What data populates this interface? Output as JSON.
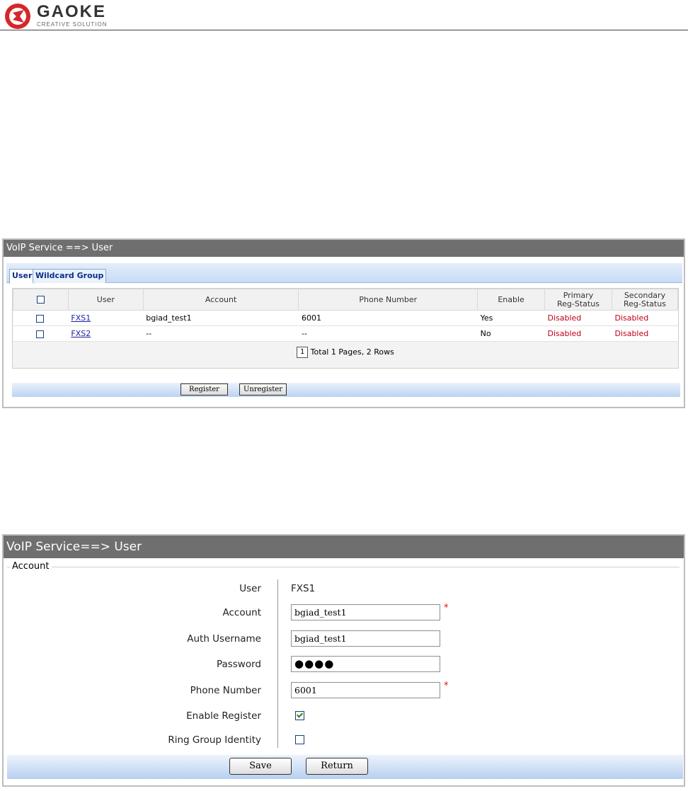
{
  "header": {
    "brand": "GAOKE",
    "tagline": "CREATIVE SOLUTION"
  },
  "colors": {
    "title_bar": "#6f6f6f",
    "tab_text": "#0b2f88",
    "status_red": "#c2001a",
    "link_blue": "#1e1fa6",
    "required_red": "#e01010"
  },
  "user_list": {
    "title": "VoIP Service ==> User",
    "tabs": [
      {
        "label": "User",
        "active": true
      },
      {
        "label": "Wildcard Group",
        "active": false
      }
    ],
    "columns": [
      "User",
      "Account",
      "Phone Number",
      "Enable",
      "Primary Reg-Status",
      "Secondary Reg-Status"
    ],
    "rows": [
      {
        "user": "FXS1",
        "account": "bgiad_test1",
        "phone": "6001",
        "enable": "Yes",
        "primary": "Disabled",
        "secondary": "Disabled"
      },
      {
        "user": "FXS2",
        "account": "--",
        "phone": "--",
        "enable": "No",
        "primary": "Disabled",
        "secondary": "Disabled"
      }
    ],
    "pager": {
      "current": "1",
      "summary": "Total 1 Pages, 2 Rows"
    },
    "buttons": {
      "register": "Register",
      "unregister": "Unregister"
    }
  },
  "user_edit": {
    "title": "VoIP Service==> User",
    "section": "Account",
    "fields": {
      "user": {
        "label": "User",
        "value": "FXS1"
      },
      "account": {
        "label": "Account",
        "value": "bgiad_test1",
        "required": "*"
      },
      "auth_username": {
        "label": "Auth Username",
        "value": "bgiad_test1"
      },
      "password": {
        "label": "Password",
        "value": "●●●●"
      },
      "phone_number": {
        "label": "Phone Number",
        "value": "6001",
        "required": "*"
      },
      "enable_register": {
        "label": "Enable Register",
        "checked": true
      },
      "ring_group_identity": {
        "label": "Ring Group Identity",
        "checked": false
      }
    },
    "buttons": {
      "save": "Save",
      "return": "Return"
    }
  }
}
